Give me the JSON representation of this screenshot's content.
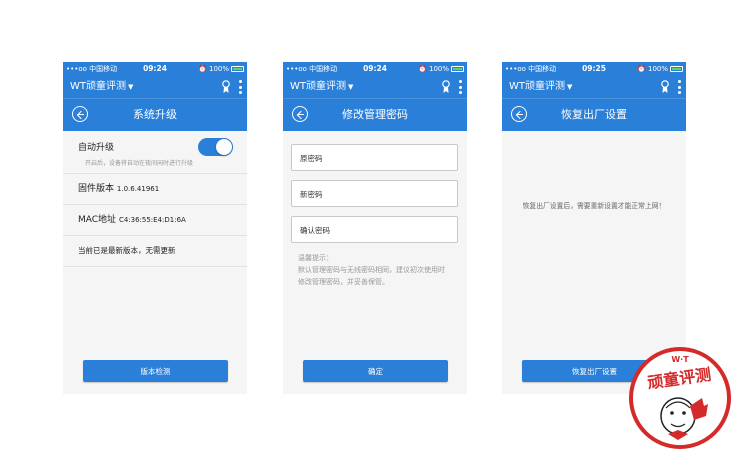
{
  "status": {
    "carrier": "•••oo 中国移动",
    "battery": "100%"
  },
  "appbar": {
    "brand": "WT顽童评测",
    "caret": "▼"
  },
  "screens": [
    {
      "time": "09:24",
      "title": "系统升级",
      "auto_upgrade": {
        "label": "自动升级",
        "hint": "开启后，设备将自动在夜间闲时进行升级",
        "enabled": true
      },
      "firmware": {
        "label": "固件版本",
        "value": "1.0.6.41961"
      },
      "mac": {
        "label": "MAC地址",
        "value": "C4:36:55:E4:D1:6A"
      },
      "status_text": "当前已是最新版本，无需更新",
      "button": "版本检测"
    },
    {
      "time": "09:24",
      "title": "修改管理密码",
      "fields": {
        "old": "原密码",
        "new": "新密码",
        "confirm": "确认密码"
      },
      "tip_title": "温馨提示：",
      "tip_body": "默认管理密码与无线密码相同，建议初次使用时修改管理密码，并妥善保管。",
      "button": "确定"
    },
    {
      "time": "09:25",
      "title": "恢复出厂设置",
      "notice": "恢复出厂设置后，需要重新设置才能正常上网！",
      "button": "恢复出厂设置"
    }
  ],
  "stamp": {
    "text": "顽童评测",
    "letters": "W·T"
  },
  "colors": {
    "primary": "#2a7fd8",
    "stamp": "#d42a2a"
  }
}
